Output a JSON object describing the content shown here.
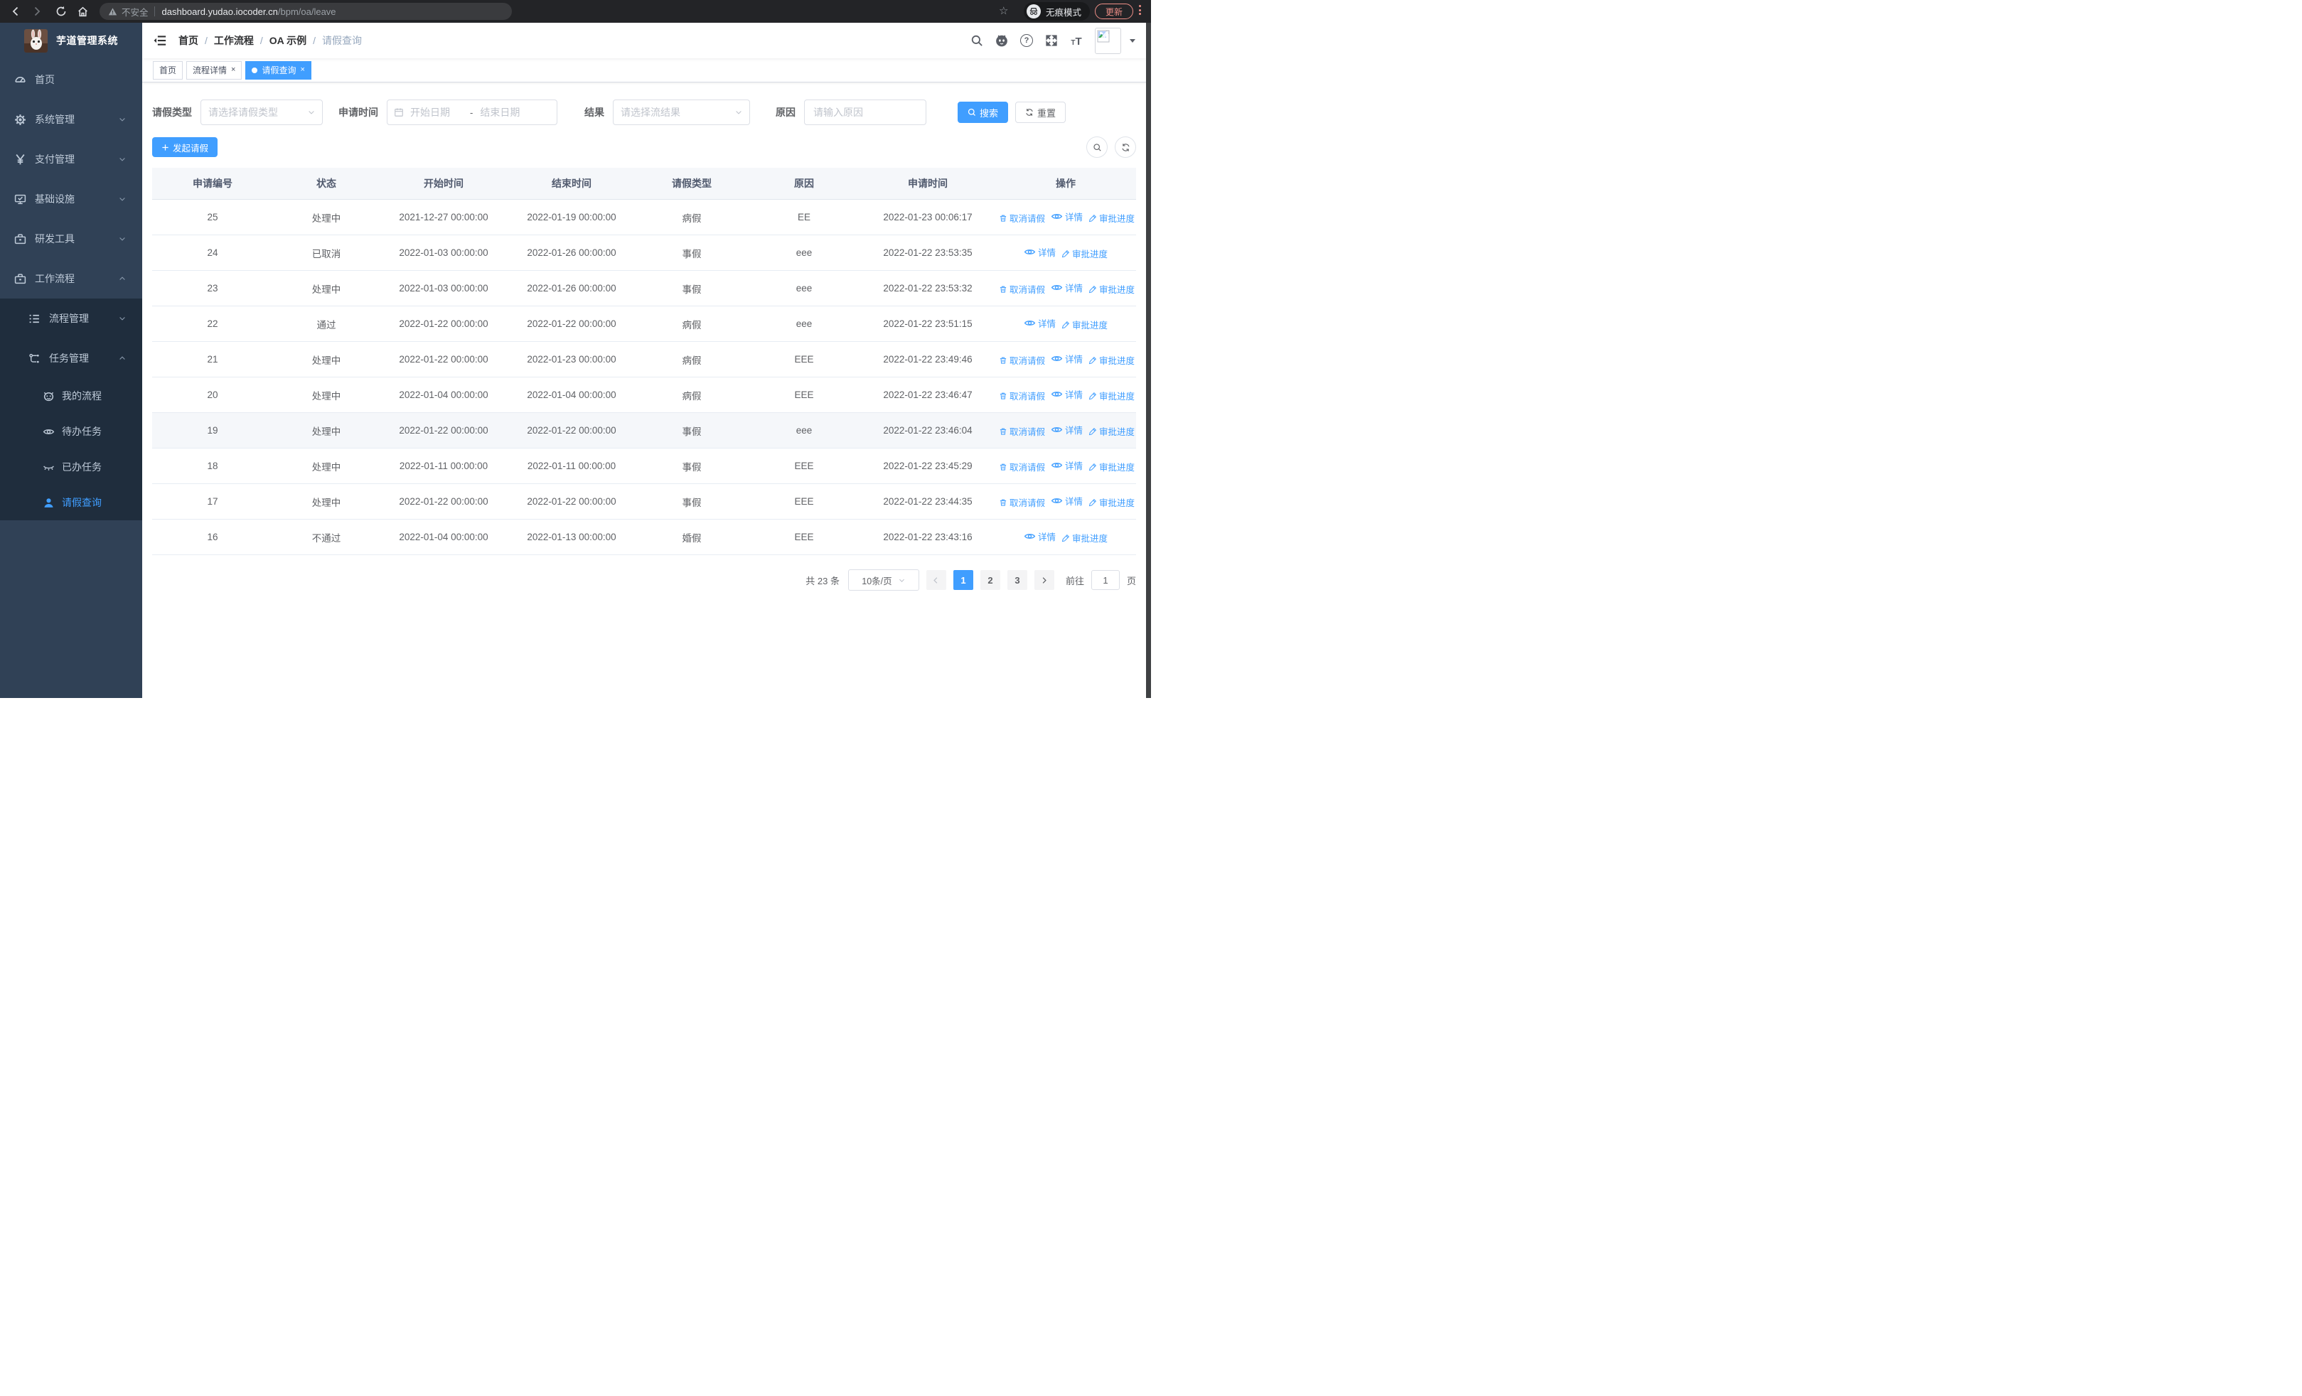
{
  "colors": {
    "accent": "#409eff",
    "sidebar_bg": "#304156",
    "submenu_bg": "#1f2d3d",
    "chrome_bg": "#232427",
    "update_accent": "#ee8e86"
  },
  "browser": {
    "security_label": "不安全",
    "url_host": "dashboard.yudao.iocoder.cn",
    "url_path": "/bpm/oa/leave",
    "incognito_label": "无痕模式",
    "update_label": "更新"
  },
  "sidebar": {
    "title": "芋道管理系统",
    "menu": [
      {
        "name": "home",
        "label": "首页",
        "icon": "dashboard-icon",
        "level": 1,
        "sub": false,
        "chevron": null,
        "active": false
      },
      {
        "name": "system-management",
        "label": "系统管理",
        "icon": "gear-icon",
        "level": 1,
        "sub": false,
        "chevron": "down",
        "active": false
      },
      {
        "name": "payment-management",
        "label": "支付管理",
        "icon": "yen-icon",
        "level": 1,
        "sub": false,
        "chevron": "down",
        "active": false
      },
      {
        "name": "infrastructure",
        "label": "基础设施",
        "icon": "monitor-icon",
        "level": 1,
        "sub": false,
        "chevron": "down",
        "active": false
      },
      {
        "name": "dev-tools",
        "label": "研发工具",
        "icon": "toolbox-icon",
        "level": 1,
        "sub": false,
        "chevron": "down",
        "active": false
      },
      {
        "name": "workflow",
        "label": "工作流程",
        "icon": "briefcase-icon",
        "level": 1,
        "sub": false,
        "chevron": "up",
        "active": false
      },
      {
        "name": "process-management",
        "label": "流程管理",
        "icon": "list-icon",
        "level": 2,
        "sub": true,
        "chevron": "down",
        "active": false
      },
      {
        "name": "task-management",
        "label": "任务管理",
        "icon": "flow-icon",
        "level": 2,
        "sub": true,
        "chevron": "up",
        "active": false
      },
      {
        "name": "my-process",
        "label": "我的流程",
        "icon": "face-icon",
        "level": 3,
        "sub": true,
        "chevron": null,
        "active": false
      },
      {
        "name": "todo-tasks",
        "label": "待办任务",
        "icon": "eye-icon",
        "level": 3,
        "sub": true,
        "chevron": null,
        "active": false
      },
      {
        "name": "done-tasks",
        "label": "已办任务",
        "icon": "eye-closed-icon",
        "level": 3,
        "sub": true,
        "chevron": null,
        "active": false
      },
      {
        "name": "leave-query",
        "label": "请假查询",
        "icon": "user-icon",
        "level": 3,
        "sub": true,
        "chevron": null,
        "active": true
      }
    ]
  },
  "header": {
    "breadcrumb": [
      "首页",
      "工作流程",
      "OA 示例",
      "请假查询"
    ],
    "separator": "/"
  },
  "tabs": [
    {
      "name": "tab-home",
      "label": "首页",
      "closable": false,
      "active": false
    },
    {
      "name": "tab-process-detail",
      "label": "流程详情",
      "closable": true,
      "active": false
    },
    {
      "name": "tab-leave-query",
      "label": "请假查询",
      "closable": true,
      "active": true
    }
  ],
  "filters": {
    "leave_type": {
      "label": "请假类型",
      "placeholder": "请选择请假类型"
    },
    "apply_time": {
      "label": "申请时间",
      "start_placeholder": "开始日期",
      "separator": "-",
      "end_placeholder": "结束日期"
    },
    "result": {
      "label": "结果",
      "placeholder": "请选择流结果"
    },
    "reason": {
      "label": "原因",
      "placeholder": "请输入原因"
    },
    "search_label": "搜索",
    "reset_label": "重置"
  },
  "toolbar": {
    "create_label": "发起请假"
  },
  "table": {
    "columns": [
      "申请编号",
      "状态",
      "开始时间",
      "结束时间",
      "请假类型",
      "原因",
      "申请时间",
      "操作"
    ],
    "actions": {
      "cancel": {
        "label": "取消请假",
        "icon": "trash-icon"
      },
      "detail": {
        "label": "详情",
        "icon": "eye-icon"
      },
      "progress": {
        "label": "审批进度",
        "icon": "edit-icon"
      }
    },
    "rows": [
      {
        "id": "25",
        "status": "处理中",
        "start": "2021-12-27 00:00:00",
        "end": "2022-01-19 00:00:00",
        "type": "病假",
        "reason": "EE",
        "applied": "2022-01-23 00:06:17",
        "actions": [
          "cancel",
          "detail",
          "progress"
        ],
        "highlight": false
      },
      {
        "id": "24",
        "status": "已取消",
        "start": "2022-01-03 00:00:00",
        "end": "2022-01-26 00:00:00",
        "type": "事假",
        "reason": "eee",
        "applied": "2022-01-22 23:53:35",
        "actions": [
          "detail",
          "progress"
        ],
        "highlight": false
      },
      {
        "id": "23",
        "status": "处理中",
        "start": "2022-01-03 00:00:00",
        "end": "2022-01-26 00:00:00",
        "type": "事假",
        "reason": "eee",
        "applied": "2022-01-22 23:53:32",
        "actions": [
          "cancel",
          "detail",
          "progress"
        ],
        "highlight": false
      },
      {
        "id": "22",
        "status": "通过",
        "start": "2022-01-22 00:00:00",
        "end": "2022-01-22 00:00:00",
        "type": "病假",
        "reason": "eee",
        "applied": "2022-01-22 23:51:15",
        "actions": [
          "detail",
          "progress"
        ],
        "highlight": false
      },
      {
        "id": "21",
        "status": "处理中",
        "start": "2022-01-22 00:00:00",
        "end": "2022-01-23 00:00:00",
        "type": "病假",
        "reason": "EEE",
        "applied": "2022-01-22 23:49:46",
        "actions": [
          "cancel",
          "detail",
          "progress"
        ],
        "highlight": false
      },
      {
        "id": "20",
        "status": "处理中",
        "start": "2022-01-04 00:00:00",
        "end": "2022-01-04 00:00:00",
        "type": "病假",
        "reason": "EEE",
        "applied": "2022-01-22 23:46:47",
        "actions": [
          "cancel",
          "detail",
          "progress"
        ],
        "highlight": false
      },
      {
        "id": "19",
        "status": "处理中",
        "start": "2022-01-22 00:00:00",
        "end": "2022-01-22 00:00:00",
        "type": "事假",
        "reason": "eee",
        "applied": "2022-01-22 23:46:04",
        "actions": [
          "cancel",
          "detail",
          "progress"
        ],
        "highlight": true
      },
      {
        "id": "18",
        "status": "处理中",
        "start": "2022-01-11 00:00:00",
        "end": "2022-01-11 00:00:00",
        "type": "事假",
        "reason": "EEE",
        "applied": "2022-01-22 23:45:29",
        "actions": [
          "cancel",
          "detail",
          "progress"
        ],
        "highlight": false
      },
      {
        "id": "17",
        "status": "处理中",
        "start": "2022-01-22 00:00:00",
        "end": "2022-01-22 00:00:00",
        "type": "事假",
        "reason": "EEE",
        "applied": "2022-01-22 23:44:35",
        "actions": [
          "cancel",
          "detail",
          "progress"
        ],
        "highlight": false
      },
      {
        "id": "16",
        "status": "不通过",
        "start": "2022-01-04 00:00:00",
        "end": "2022-01-13 00:00:00",
        "type": "婚假",
        "reason": "EEE",
        "applied": "2022-01-22 23:43:16",
        "actions": [
          "detail",
          "progress"
        ],
        "highlight": false
      }
    ]
  },
  "pagination": {
    "total_label": "共 23 条",
    "page_size_label": "10条/页",
    "pages": [
      "1",
      "2",
      "3"
    ],
    "active_page": "1",
    "goto_label": "前往",
    "goto_value": "1",
    "page_suffix_label": "页"
  }
}
